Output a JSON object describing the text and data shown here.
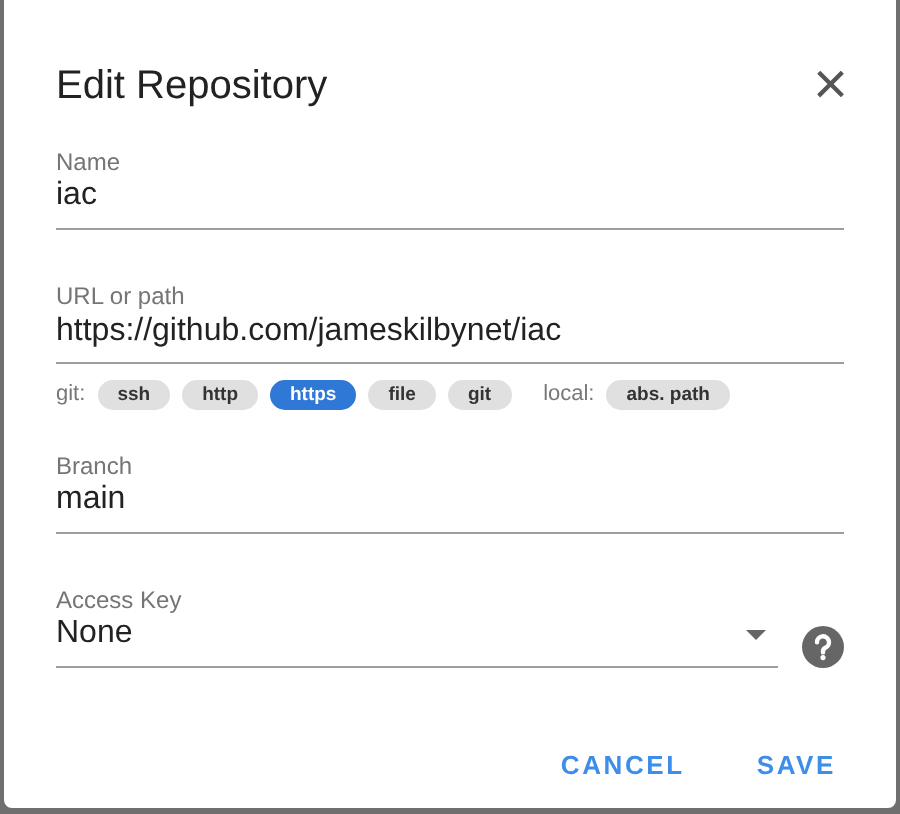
{
  "dialog": {
    "title": "Edit Repository",
    "close": "×"
  },
  "fields": [
    {
      "label": "Name",
      "value": "iac"
    },
    {
      "label": "URL or path",
      "value": "https://github.com/jameskilbynet/iac"
    }
  ],
  "chip_groups": [
    {
      "label": "git:",
      "chips": [
        {
          "text": "ssh",
          "selected": false
        },
        {
          "text": "http",
          "selected": false
        },
        {
          "text": "https",
          "selected": true
        },
        {
          "text": "file",
          "selected": false
        },
        {
          "text": "git",
          "selected": false
        }
      ]
    },
    {
      "label": "local:",
      "chips": [
        {
          "text": "abs. path",
          "selected": false
        }
      ]
    }
  ],
  "branch": {
    "label": "Branch",
    "value": "main"
  },
  "access_key": {
    "label": "Access Key",
    "value": "None"
  },
  "buttons": [
    "CANCEL",
    "SAVE"
  ]
}
